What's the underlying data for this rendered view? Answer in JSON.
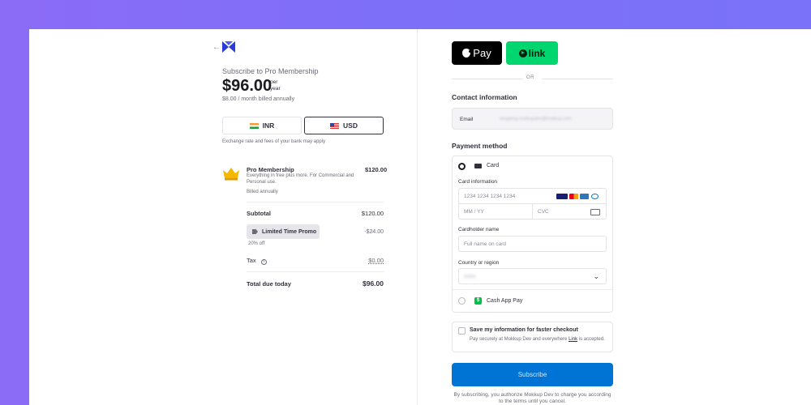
{
  "product": {
    "back_icon": "arrow-left-icon",
    "logo_icon": "mokkup-logo",
    "name": "Subscribe to Pro Membership",
    "price": "$96.00",
    "per_line1": "per",
    "per_line2": "year",
    "billing_note": "$8.00 / month billed annually"
  },
  "currency": {
    "options": [
      {
        "code": "INR",
        "flag": "india-flag-icon",
        "selected": false
      },
      {
        "code": "USD",
        "flag": "us-flag-icon",
        "selected": true
      }
    ],
    "note": "Exchange rate and fees of your bank may apply"
  },
  "line_item": {
    "icon": "crown-icon",
    "title": "Pro Membership",
    "price": "$120.00",
    "description": "Everything in free plus more. For Commercial and Personal use.",
    "billed": "Billed annually"
  },
  "summary": {
    "subtotal_label": "Subtotal",
    "subtotal_value": "$120.00",
    "promo_label": "Limited Time Promo",
    "promo_note": "20% off",
    "promo_value": "-$24.00",
    "tax_label": "Tax",
    "tax_value": "$0.00",
    "total_label": "Total due today",
    "total_value": "$96.00"
  },
  "express": {
    "apple_pay_label": "Pay",
    "link_label": "link",
    "or_label": "OR"
  },
  "contact": {
    "title": "Contact information",
    "email_label": "Email",
    "email_value": "shopping.mokkupdev@mokkup.com"
  },
  "payment": {
    "title": "Payment method",
    "card_label": "Card",
    "card_info_label": "Card information",
    "card_number_placeholder": "1234 1234 1234 1234",
    "expiry_placeholder": "MM / YY",
    "cvc_placeholder": "CVC",
    "holder_label": "Cardholder name",
    "holder_placeholder": "Full name on card",
    "country_label": "Country or region",
    "country_value": "India",
    "cashapp_label": "Cash App Pay",
    "card_brands": [
      "visa",
      "mastercard",
      "amex",
      "diners"
    ]
  },
  "save_info": {
    "title": "Save my information for faster checkout",
    "desc_before": "Pay securely at Mokkup Dev and everywhere ",
    "desc_link": "Link",
    "desc_after": " is accepted."
  },
  "subscribe_label": "Subscribe",
  "terms": "By subscribing, you authorize Mokkup Dev to charge you according to the terms until you cancel.",
  "colors": {
    "background_gradient_start": "#8b6cf7",
    "accent": "#0074d4",
    "link_green": "#00d66f"
  }
}
